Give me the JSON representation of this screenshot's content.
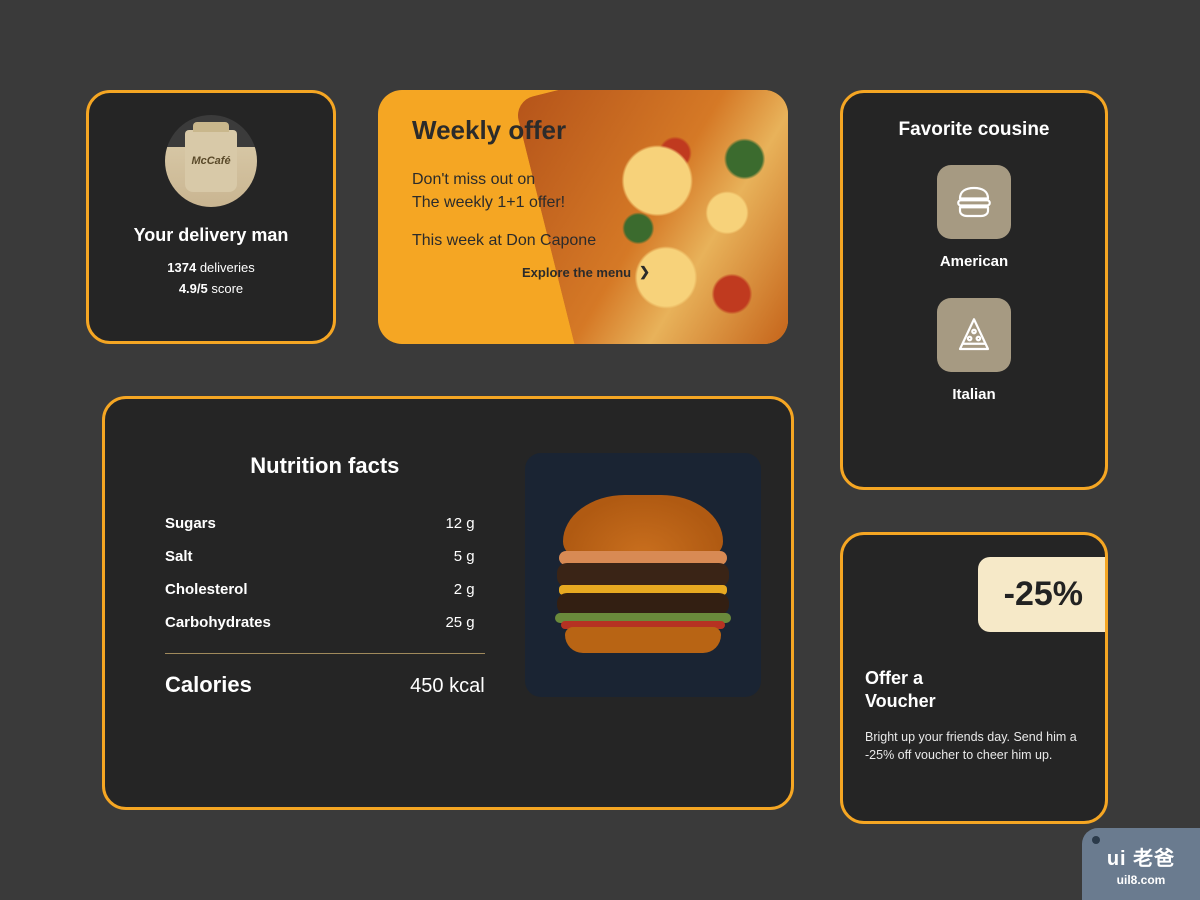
{
  "delivery": {
    "title": "Your delivery man",
    "count": "1374",
    "count_label": "deliveries",
    "score": "4.9/5",
    "score_label": "score",
    "bag_text": "McCafé"
  },
  "offer": {
    "title": "Weekly offer",
    "desc_line1": "Don't miss out on",
    "desc_line2": "The weekly 1+1 offer!",
    "week": "This week at Don Capone",
    "cta": "Explore the menu"
  },
  "cuisine": {
    "title": "Favorite cousine",
    "items": [
      {
        "label": "American"
      },
      {
        "label": "Italian"
      }
    ]
  },
  "nutrition": {
    "title": "Nutrition facts",
    "rows": [
      {
        "label": "Sugars",
        "value": "12 g"
      },
      {
        "label": "Salt",
        "value": "5 g"
      },
      {
        "label": "Cholesterol",
        "value": "2 g"
      },
      {
        "label": "Carbohydrates",
        "value": "25 g"
      }
    ],
    "calories_label": "Calories",
    "calories_value": "450 kcal"
  },
  "voucher": {
    "badge": "-25%",
    "title_line1": "Offer a",
    "title_line2": "Voucher",
    "desc": "Bright up your friends day. Send him a -25% off voucher to cheer him up."
  },
  "watermark": {
    "top": "ui 老爸",
    "bot": "uil8.com"
  }
}
